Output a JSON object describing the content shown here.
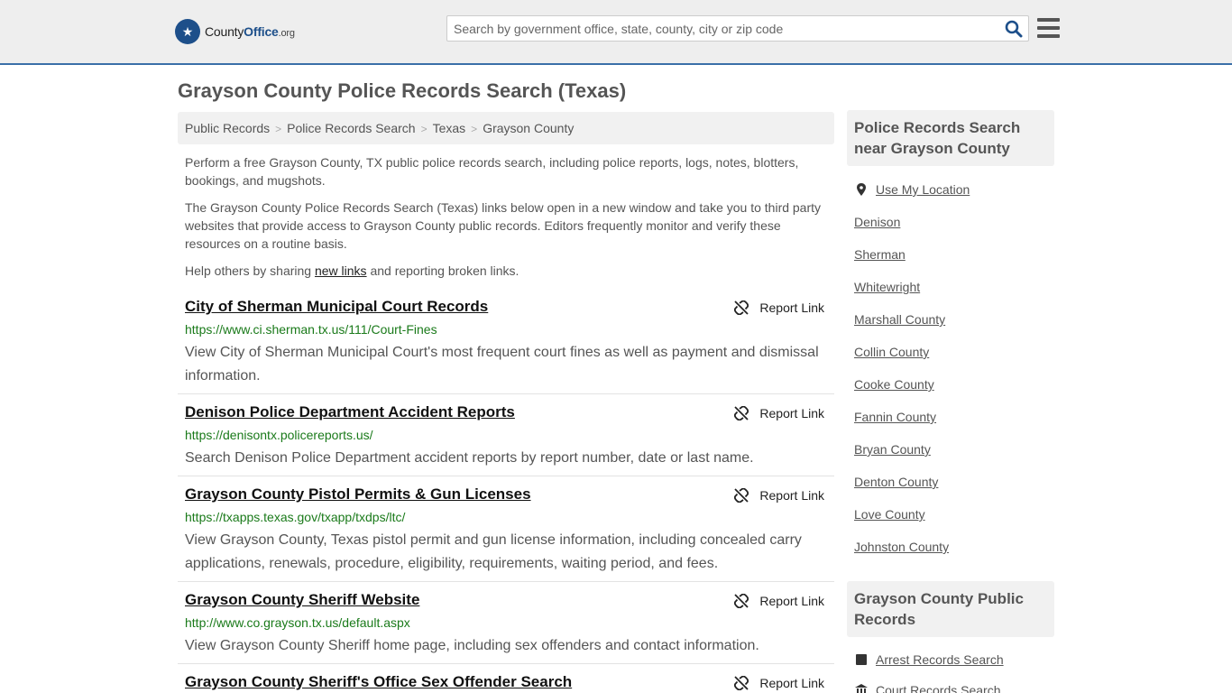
{
  "header": {
    "logo_main": "County",
    "logo_accent": "Office",
    "logo_tld": ".org",
    "search_placeholder": "Search by government office, state, county, city or zip code"
  },
  "page_title": "Grayson County Police Records Search (Texas)",
  "breadcrumb": [
    "Public Records",
    "Police Records Search",
    "Texas",
    "Grayson County"
  ],
  "intro": {
    "p1": "Perform a free Grayson County, TX public police records search, including police reports, logs, notes, blotters, bookings, and mugshots.",
    "p2": "The Grayson County Police Records Search (Texas) links below open in a new window and take you to third party websites that provide access to Grayson County public records. Editors frequently monitor and verify these resources on a routine basis.",
    "p3_before": "Help others by sharing ",
    "p3_link": "new links",
    "p3_after": " and reporting broken links."
  },
  "report_label": "Report Link",
  "results": [
    {
      "title": "City of Sherman Municipal Court Records",
      "url": "https://www.ci.sherman.tx.us/111/Court-Fines",
      "desc": "View City of Sherman Municipal Court's most frequent court fines as well as payment and dismissal information."
    },
    {
      "title": "Denison Police Department Accident Reports",
      "url": "https://denisontx.policereports.us/",
      "desc": "Search Denison Police Department accident reports by report number, date or last name."
    },
    {
      "title": "Grayson County Pistol Permits & Gun Licenses",
      "url": "https://txapps.texas.gov/txapp/txdps/ltc/",
      "desc": "View Grayson County, Texas pistol permit and gun license information, including concealed carry applications, renewals, procedure, eligibility, requirements, waiting period, and fees."
    },
    {
      "title": "Grayson County Sheriff Website",
      "url": "http://www.co.grayson.tx.us/default.aspx",
      "desc": "View Grayson County Sheriff home page, including sex offenders and contact information."
    },
    {
      "title": "Grayson County Sheriff's Office Sex Offender Search",
      "url": "",
      "desc": ""
    }
  ],
  "sidebar": {
    "nearby_heading": "Police Records Search near Grayson County",
    "use_location": "Use My Location",
    "nearby": [
      "Denison",
      "Sherman",
      "Whitewright",
      "Marshall County",
      "Collin County",
      "Cooke County",
      "Fannin County",
      "Bryan County",
      "Denton County",
      "Love County",
      "Johnston County"
    ],
    "public_heading": "Grayson County Public Records",
    "public_links": [
      "Arrest Records Search",
      "Court Records Search"
    ]
  }
}
